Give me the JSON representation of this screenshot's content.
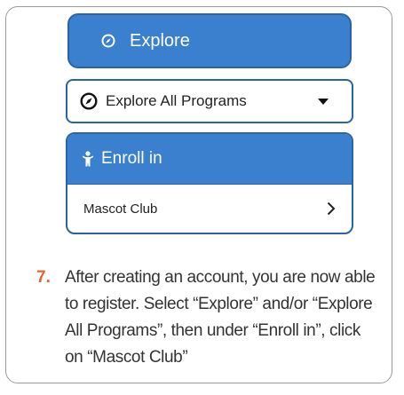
{
  "explore_button": {
    "label": "Explore",
    "icon": "compass-icon",
    "color": "#3b7fcf"
  },
  "programs_select": {
    "label": "Explore All Programs",
    "icon": "compass-icon",
    "caret_icon": "caret-down-icon"
  },
  "enroll_panel": {
    "header_label": "Enroll in",
    "header_icon": "person-icon",
    "items": [
      {
        "label": "Mascot Club",
        "icon": "chevron-right-icon"
      }
    ]
  },
  "instruction": {
    "number": "7.",
    "number_color": "#e8632b",
    "text": "After creating an account, you are now able to register. Select “Explore” and/or “Explore All Programs”, then under “Enroll in”, click on “Mascot Club”"
  }
}
